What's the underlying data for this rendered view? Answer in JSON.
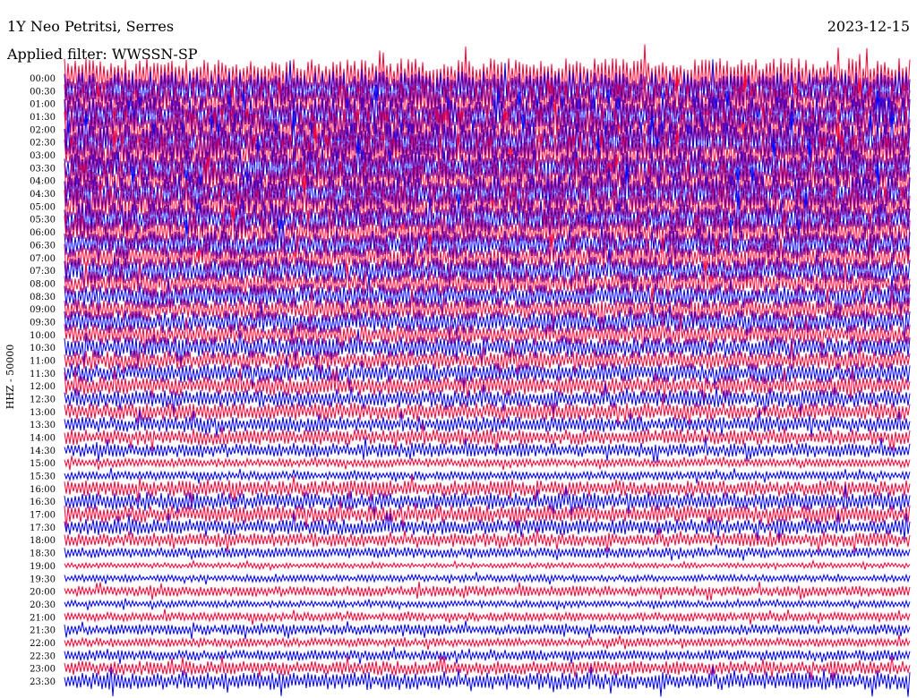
{
  "header": {
    "title": "1Y Neo Petritsi, Serres",
    "date": "2023-12-15",
    "filter": "Applied filter: WWSSN-SP"
  },
  "chart_data": {
    "type": "line",
    "title": "1Y Neo Petritsi, Serres",
    "subtitle": "Applied filter: WWSSN-SP",
    "ylabel": "HHZ - 50000",
    "xlabel": "",
    "y_tick_labels": [
      "00:00",
      "00:30",
      "01:00",
      "01:30",
      "02:00",
      "02:30",
      "03:00",
      "03:30",
      "04:00",
      "04:30",
      "05:00",
      "05:30",
      "06:00",
      "06:30",
      "07:00",
      "07:30",
      "08:00",
      "08:30",
      "09:00",
      "09:30",
      "10:00",
      "10:30",
      "11:00",
      "11:30",
      "12:00",
      "12:30",
      "13:00",
      "13:30",
      "14:00",
      "14:30",
      "15:00",
      "15:30",
      "16:00",
      "16:30",
      "17:00",
      "17:30",
      "18:00",
      "18:30",
      "19:00",
      "19:30",
      "20:00",
      "20:30",
      "21:00",
      "21:30",
      "22:00",
      "22:30",
      "23:00",
      "23:30"
    ],
    "line_amplitude": [
      22,
      22,
      22,
      22,
      22,
      22,
      22,
      20,
      20,
      20,
      20,
      18,
      18,
      16,
      16,
      15,
      14,
      14,
      13,
      13,
      12,
      12,
      11,
      11,
      11,
      10,
      10,
      9,
      9,
      8,
      5,
      5,
      9,
      10,
      10,
      9,
      8,
      6,
      3,
      4,
      6,
      4,
      5,
      6,
      5,
      6,
      8,
      10
    ],
    "series_colors": [
      "#ff0033",
      "#0000ff"
    ],
    "trace_order": "alternating, starting with red at 00:00",
    "grid": false,
    "legend": "none"
  }
}
